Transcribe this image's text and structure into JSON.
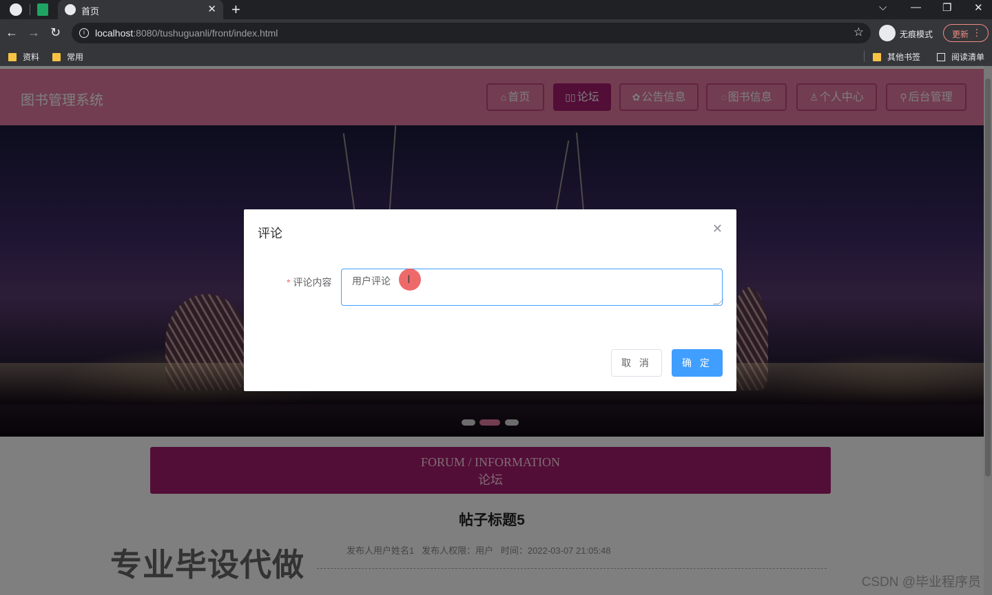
{
  "browser": {
    "tab_title": "首页",
    "url_host": "localhost",
    "url_path": ":8080/tushuguanli/front/index.html",
    "profile_label": "无痕模式",
    "update_label": "更新",
    "bookmarks": [
      "资料",
      "常用"
    ],
    "bookmarks_right": [
      "其他书签",
      "阅读清单"
    ]
  },
  "site": {
    "title": "图书管理系统",
    "nav": [
      {
        "icon": "home-icon",
        "glyph": "⌂",
        "label": "首页",
        "active": false
      },
      {
        "icon": "forum-icon",
        "glyph": "▯▯",
        "label": "论坛",
        "active": true
      },
      {
        "icon": "notice-icon",
        "glyph": "✿",
        "label": "公告信息",
        "active": false
      },
      {
        "icon": "book-icon",
        "glyph": "◌",
        "label": "图书信息",
        "active": false
      },
      {
        "icon": "user-icon",
        "glyph": "♙",
        "label": "个人中心",
        "active": false
      },
      {
        "icon": "link-icon",
        "glyph": "⚲",
        "label": "后台管理",
        "active": false
      }
    ],
    "carousel_active_index": 1
  },
  "forum": {
    "heading_en": "FORUM / INFORMATION",
    "heading_cn": "论坛",
    "post_title": "帖子标题5",
    "post_meta": "发布人用户姓名1   发布人权限：用户   时间：2022-03-07 21:05:48"
  },
  "dialog": {
    "title": "评论",
    "field_label": "评论内容",
    "field_value": "用户评论",
    "cancel_label": "取 消",
    "confirm_label": "确 定"
  },
  "watermarks": {
    "big": "专业毕设代做",
    "csdn": "CSDN @毕业程序员"
  },
  "colors": {
    "header": "#e57ba0",
    "active_nav": "#a61d6f",
    "primary": "#409eff"
  }
}
